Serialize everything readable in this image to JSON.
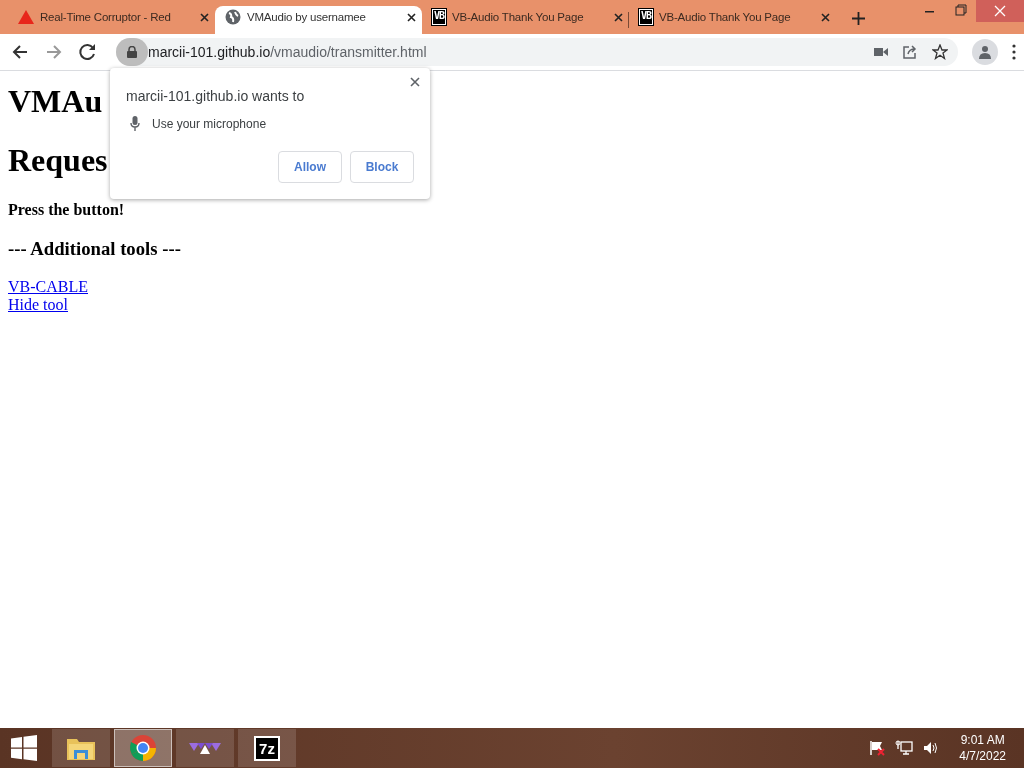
{
  "browser": {
    "tabs": [
      {
        "kind": "warning",
        "title": "Real-Time Corruptor - Red",
        "selected": false
      },
      {
        "kind": "globe",
        "title": "VMAudio by usernamee",
        "selected": true
      },
      {
        "kind": "vb",
        "icon_text": "VB",
        "title": "VB-Audio Thank You Page",
        "selected": false
      },
      {
        "kind": "vb",
        "icon_text": "VB",
        "title": "VB-Audio Thank You Page",
        "selected": false
      }
    ],
    "address": "marcii-101.github.io/vmaudio/transmitter.html"
  },
  "page": {
    "title": "VMAu",
    "status": "Reques",
    "prompt": "Press the button!",
    "section": "--- Additional tools ---",
    "links": [
      "VB-CABLE",
      "Hide tool"
    ]
  },
  "permission_popup": {
    "origin_text": "marcii-101.github.io wants to",
    "permission": "Use your microphone",
    "buttons": [
      "Allow",
      "Block"
    ]
  },
  "taskbar": {
    "apps": [
      {
        "kind": "folder",
        "selected": false
      },
      {
        "kind": "chrome",
        "selected": true
      },
      {
        "kind": "triangles",
        "selected": false
      },
      {
        "kind": "sevenzip",
        "label": "7z",
        "selected": false
      }
    ],
    "time": "9:01 AM",
    "date": "4/7/2022"
  }
}
